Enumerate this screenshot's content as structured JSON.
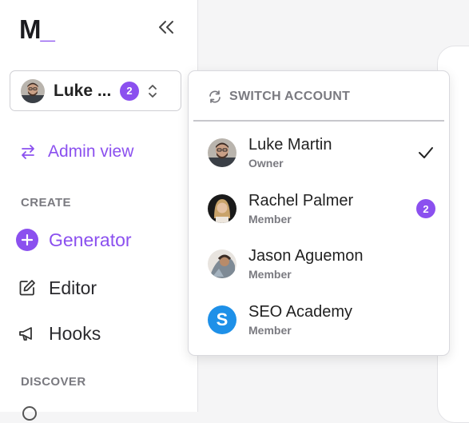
{
  "app": {
    "logo_letter": "M",
    "logo_cursor": "_",
    "accent_color": "#8b50ef"
  },
  "sidebar": {
    "collapse_icon": "double-chevron-left-icon",
    "switcher": {
      "current_name": "Luke ...",
      "badge_count": "2",
      "icon": "chevron-up-down-icon"
    },
    "admin_view": {
      "label": "Admin view",
      "icon": "swap-arrows-icon"
    },
    "sections": [
      {
        "label": "CREATE",
        "items": [
          {
            "label": "Generator",
            "icon": "plus-circle-icon",
            "active": true
          },
          {
            "label": "Editor",
            "icon": "edit-icon",
            "active": false
          },
          {
            "label": "Hooks",
            "icon": "megaphone-icon",
            "active": false
          }
        ]
      },
      {
        "label": "DISCOVER",
        "items": []
      }
    ]
  },
  "dropdown": {
    "header": "SWITCH ACCOUNT",
    "header_icon": "refresh-icon",
    "accounts": [
      {
        "name": "Luke Martin",
        "role": "Owner",
        "selected": true,
        "badge": ""
      },
      {
        "name": "Rachel Palmer",
        "role": "Member",
        "selected": false,
        "badge": "2"
      },
      {
        "name": "Jason Aguemon",
        "role": "Member",
        "selected": false,
        "badge": ""
      },
      {
        "name": "SEO Academy",
        "role": "Member",
        "selected": false,
        "badge": "",
        "logo_letter": "S"
      }
    ]
  }
}
